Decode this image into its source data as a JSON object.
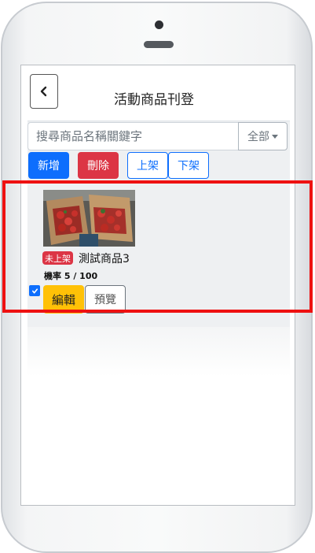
{
  "header": {
    "title": "活動商品刊登"
  },
  "search": {
    "placeholder": "搜尋商品名稱關鍵字",
    "filter_label": "全部"
  },
  "toolbar": {
    "add_label": "新增",
    "delete_label": "刪除",
    "list_label": "上架",
    "unlist_label": "下架"
  },
  "product": {
    "status": "未上架",
    "name": "測試商品3",
    "probability": "機率 5 / 100",
    "checked": true,
    "edit_label": "編輯",
    "preview_label": "預覽"
  },
  "colors": {
    "primary": "#0d6efd",
    "danger": "#dc3545",
    "warning": "#ffc107",
    "highlight": "#ee1111"
  }
}
